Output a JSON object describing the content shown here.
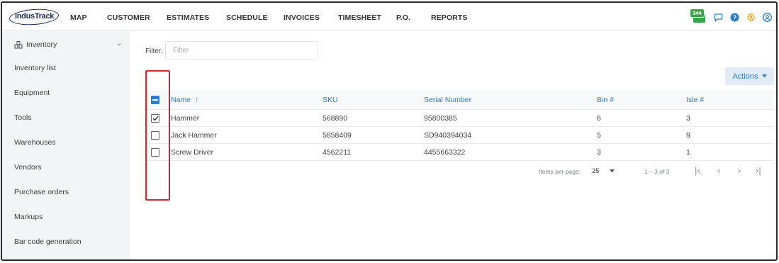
{
  "app": {
    "logo": "IndusTrack"
  },
  "nav": {
    "items": [
      "MAP",
      "CUSTOMER",
      "ESTIMATES",
      "SCHEDULE",
      "INVOICES",
      "TIMESHEET",
      "P.O.",
      "REPORTS"
    ],
    "messages_count": "344"
  },
  "sidebar": {
    "section": "Inventory",
    "items": [
      "Inventory list",
      "Equipment",
      "Tools",
      "Warehouses",
      "Vendors",
      "Purchase orders",
      "Markups",
      "Bar code generation"
    ]
  },
  "filter": {
    "label": "Filter:",
    "placeholder": "Filter",
    "value": ""
  },
  "actions": {
    "label": "Actions"
  },
  "table": {
    "columns": [
      "Name",
      "SKU",
      "Serial Number",
      "Bin #",
      "Isle #"
    ],
    "sort_indicator": "↑",
    "rows": [
      {
        "name": "Hammer",
        "sku": "568890",
        "serial": "95800385",
        "bin": "6",
        "isle": "3",
        "checked": true
      },
      {
        "name": "Jack Hammer",
        "sku": "5858409",
        "serial": "SD940394034",
        "bin": "5",
        "isle": "9",
        "checked": false
      },
      {
        "name": "Screw Driver",
        "sku": "4562211",
        "serial": "4455663322",
        "bin": "3",
        "isle": "1",
        "checked": false
      }
    ]
  },
  "pagination": {
    "items_per_page_label": "Items per page:",
    "items_per_page": "25",
    "range": "1 – 3 of 3"
  },
  "colors": {
    "accent": "#2a7dc9",
    "highlight": "#d3272f",
    "badge": "#3aa34a",
    "sidebar_bg": "#f3f4f6"
  }
}
